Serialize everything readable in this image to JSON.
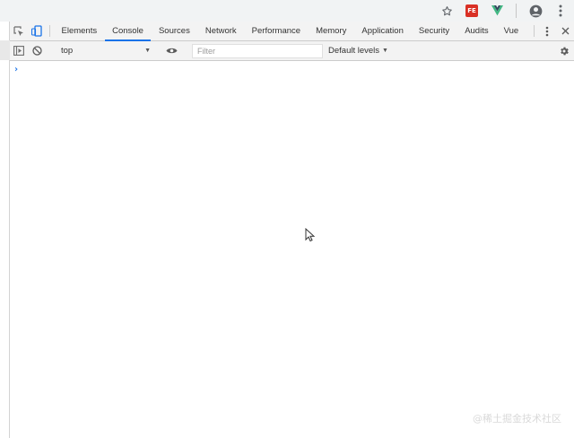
{
  "browser": {
    "extensions": [
      {
        "name": "star-icon"
      },
      {
        "name": "fe-extension-icon",
        "label": "FE",
        "color": "#d93025"
      },
      {
        "name": "vue-devtools-icon",
        "color": "#41b883"
      },
      {
        "name": "account-icon"
      },
      {
        "name": "more-vert-icon"
      }
    ]
  },
  "devtools": {
    "tabs": [
      {
        "label": "Elements",
        "active": false
      },
      {
        "label": "Console",
        "active": true
      },
      {
        "label": "Sources",
        "active": false
      },
      {
        "label": "Network",
        "active": false
      },
      {
        "label": "Performance",
        "active": false
      },
      {
        "label": "Memory",
        "active": false
      },
      {
        "label": "Application",
        "active": false
      },
      {
        "label": "Security",
        "active": false
      },
      {
        "label": "Audits",
        "active": false
      },
      {
        "label": "Vue",
        "active": false
      }
    ],
    "accent_color": "#1a73e8",
    "close_glyph": "✕",
    "more_glyph": "⋮"
  },
  "console": {
    "context": "top",
    "context_arrow": "▼",
    "filter_placeholder": "Filter",
    "filter_value": "",
    "levels_label": "Default levels",
    "levels_arrow": "▼",
    "prompt_symbol": "›"
  },
  "watermark": "@稀土掘金技术社区"
}
